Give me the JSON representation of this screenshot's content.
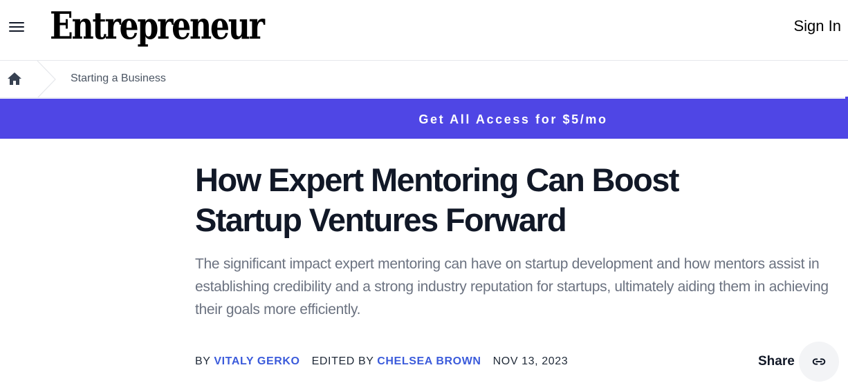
{
  "header": {
    "logo_text": "Entrepreneur",
    "sign_in_label": "Sign In"
  },
  "breadcrumb": {
    "home_icon": "home-icon",
    "items": [
      {
        "label": "Starting a Business"
      }
    ]
  },
  "promo": {
    "label": "Get All Access for $5/mo",
    "background_color": "#4f46e5"
  },
  "article": {
    "title": "How Expert Mentoring Can Boost Startup Ventures Forward",
    "dek": "The significant impact expert mentoring can have on startup development and how mentors assist in establishing credibility and a strong industry reputation for startups, ultimately aiding them in achieving their goals more efficiently.",
    "byline": {
      "by_label": "BY",
      "author": "VITALY GERKO",
      "edited_label": "EDITED BY",
      "editor": "CHELSEA BROWN",
      "date": "NOV 13, 2023"
    },
    "share": {
      "label": "Share",
      "icon": "link-icon"
    }
  },
  "colors": {
    "accent": "#4f46e5",
    "author_link": "#3b5bdb",
    "headline": "#111827",
    "dek": "#6b7280"
  }
}
